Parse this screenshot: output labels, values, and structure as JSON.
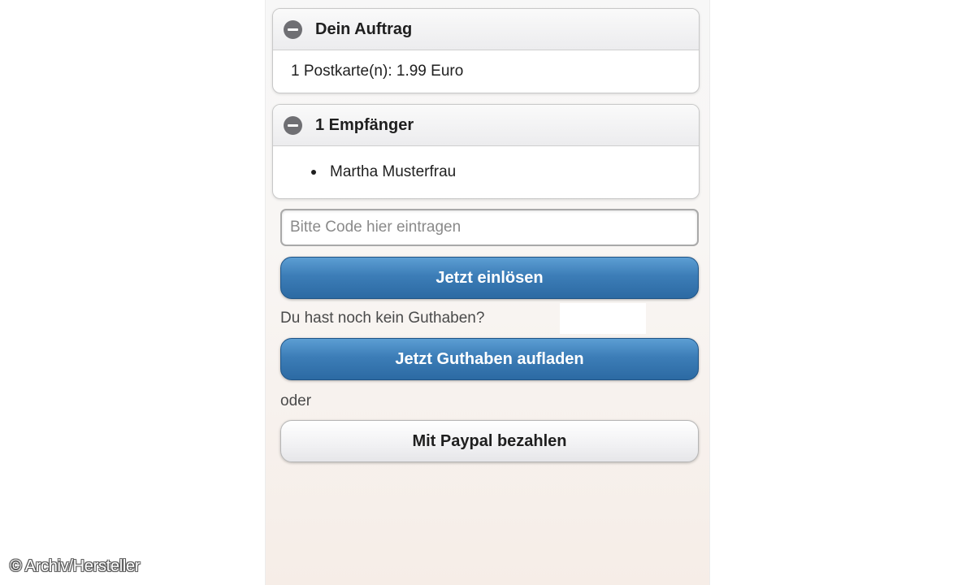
{
  "order_section": {
    "title": "Dein Auftrag",
    "summary": "1 Postkarte(n): 1.99 Euro"
  },
  "recipients_section": {
    "title": "1 Empfänger",
    "items": [
      "Martha Musterfrau"
    ]
  },
  "code_input": {
    "value": "",
    "placeholder": "Bitte Code hier eintragen"
  },
  "redeem_button": {
    "label": "Jetzt einlösen"
  },
  "no_credit_text": "Du hast noch kein Guthaben?",
  "topup_button": {
    "label": "Jetzt Guthaben aufladen"
  },
  "or_text": "oder",
  "paypal_button": {
    "label": "Mit Paypal bezahlen"
  },
  "copyright": "© Archiv/Hersteller",
  "colors": {
    "primary_button": "#3c7db7",
    "icon_gray": "#6f6f73"
  },
  "icons": {
    "collapse": "minus-circle-icon"
  }
}
